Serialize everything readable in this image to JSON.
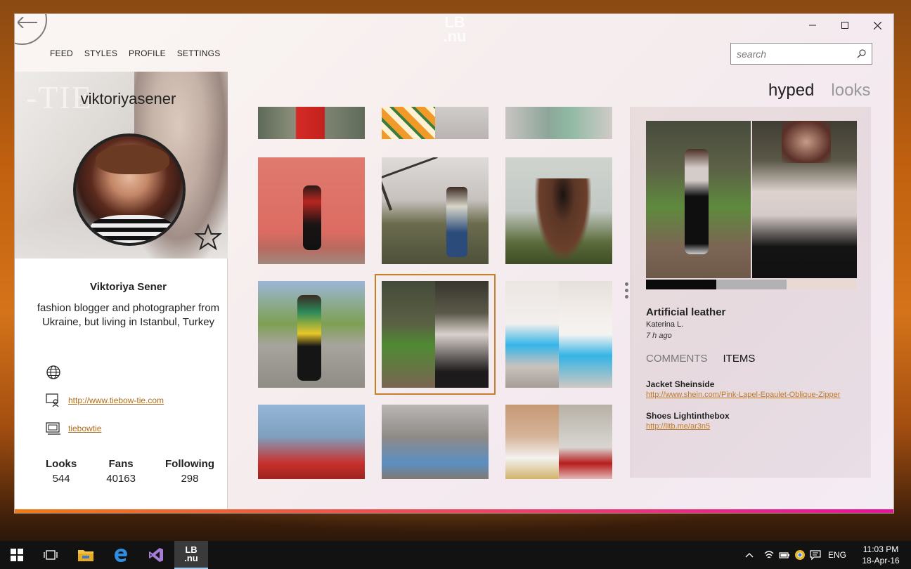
{
  "app": {
    "logo_line1": "LB",
    "logo_line2": ".nu"
  },
  "nav": [
    {
      "label": "FEED"
    },
    {
      "label": "STYLES"
    },
    {
      "label": "PROFILE"
    },
    {
      "label": "SETTINGS"
    }
  ],
  "search": {
    "placeholder": "search"
  },
  "profile": {
    "username": "viktoriyasener",
    "hero_text": "-TIE",
    "full_name": "Viktoriya Sener",
    "bio": "fashion blogger and photographer from Ukraine, but living in Istanbul, Turkey",
    "website": "http://www.tiebow-tie.com",
    "blog": "tiebowtie",
    "stats": [
      {
        "label": "Looks",
        "value": "544"
      },
      {
        "label": "Fans",
        "value": "40163"
      },
      {
        "label": "Following",
        "value": "298"
      }
    ]
  },
  "tabs": {
    "hyped": "hyped",
    "looks": "looks"
  },
  "detail": {
    "title": "Artificial leather",
    "author": "Katerina L.",
    "time": "7 h ago",
    "tab_comments": "COMMENTS",
    "tab_items": "ITEMS",
    "palette": [
      "#0b0b0b",
      "#b2b1b3",
      "#e8d9d5"
    ],
    "items": [
      {
        "name": "Jacket Sheinside",
        "link": "http://www.shein.com/Pink-Lapel-Epaulet-Oblique-Zipper"
      },
      {
        "name": "Shoes Lightinthebox",
        "link": "http://litb.me/ar3n5"
      }
    ]
  },
  "taskbar": {
    "app_label_line1": "LB",
    "app_label_line2": ".nu",
    "lang": "ENG",
    "time": "11:03 PM",
    "date": "18-Apr-16"
  }
}
